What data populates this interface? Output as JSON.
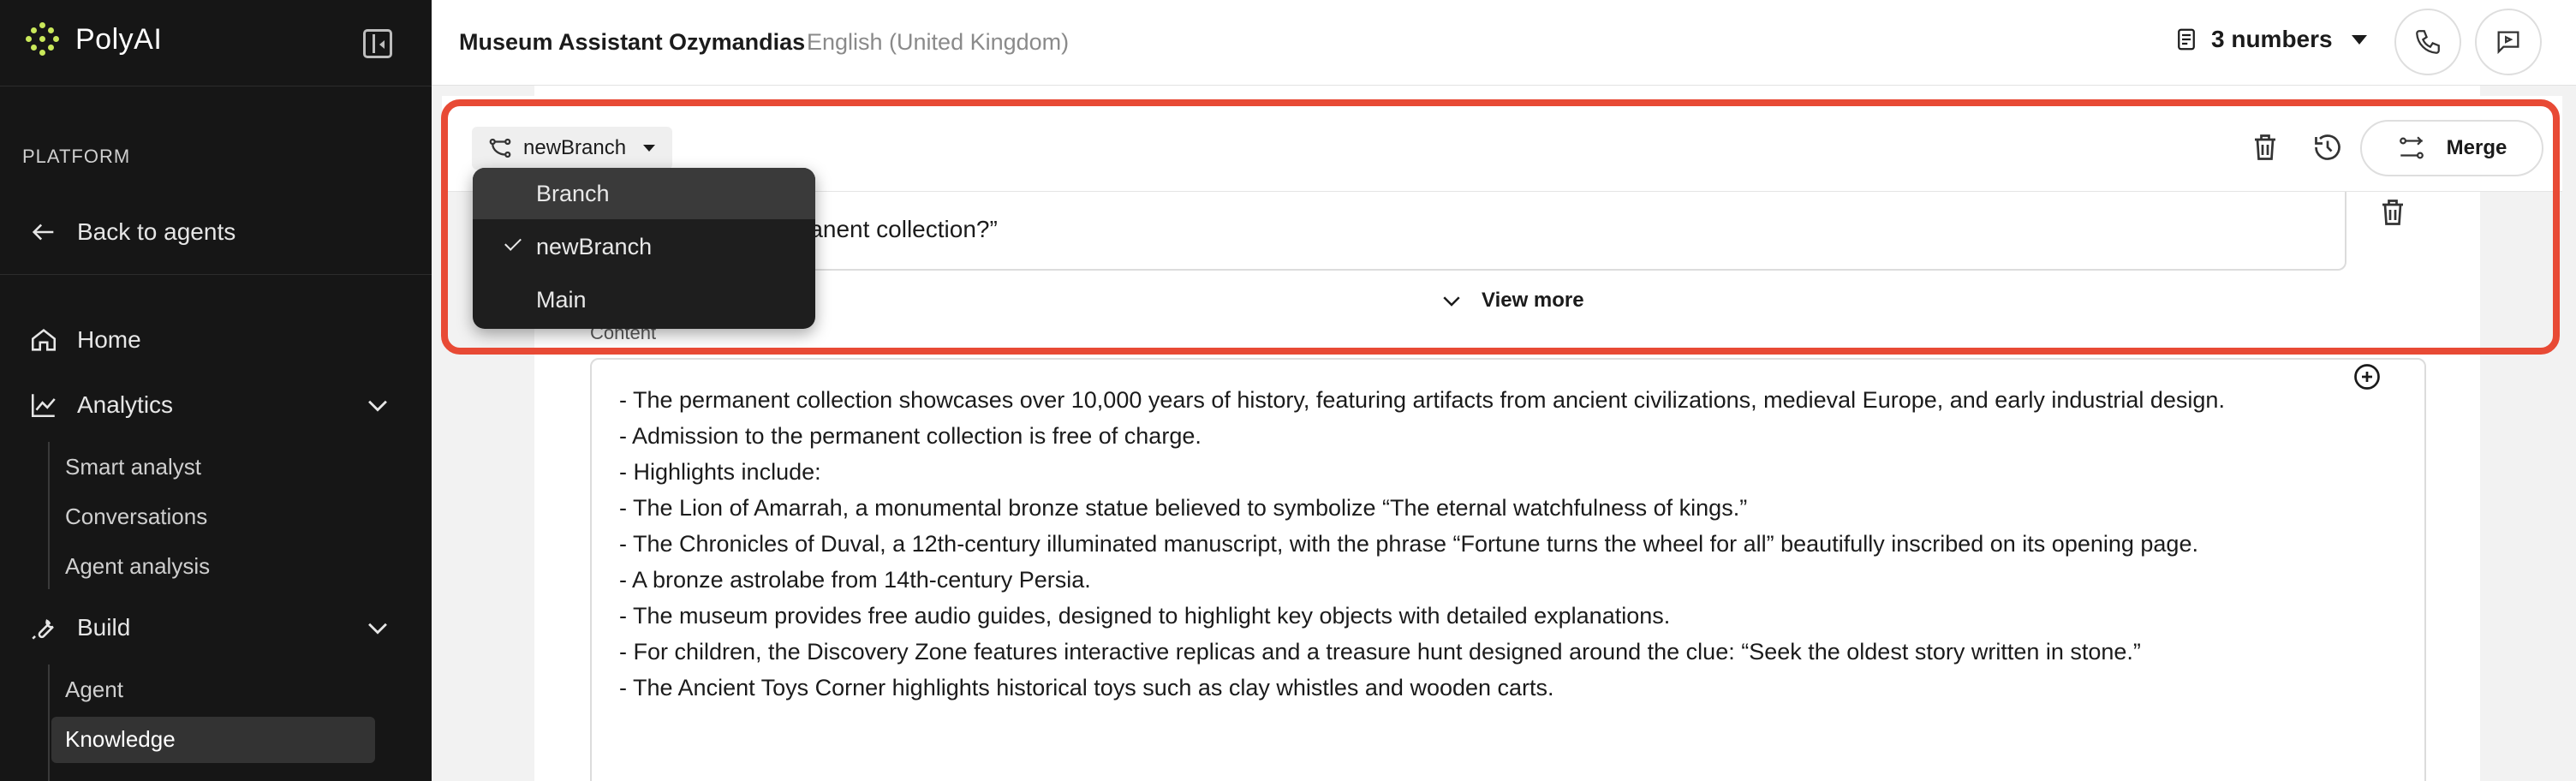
{
  "app": {
    "name": "PolyAI"
  },
  "sidebar": {
    "section_label": "PLATFORM",
    "back_label": "Back to agents",
    "home_label": "Home",
    "analytics_label": "Analytics",
    "analytics_items": [
      "Smart analyst",
      "Conversations",
      "Agent analysis"
    ],
    "build_label": "Build",
    "build_items": [
      "Agent",
      "Knowledge"
    ],
    "active_item": "Knowledge"
  },
  "header": {
    "agent_name": "Museum Assistant Ozymandias",
    "language": "English (United Kingdom)",
    "numbers_label": "3 numbers"
  },
  "branch": {
    "current": "newBranch",
    "merge_label": "Merge",
    "dropdown": {
      "items": [
        {
          "label": "Branch",
          "highlighted": true,
          "checked": false
        },
        {
          "label": "newBranch",
          "highlighted": false,
          "checked": true
        },
        {
          "label": "Main",
          "highlighted": false,
          "checked": false
        }
      ]
    }
  },
  "knowledge": {
    "question_partial": "manent collection?”",
    "view_more_label": "View more",
    "content_label": "Content",
    "content_lines": [
      "- The permanent collection showcases over 10,000 years of history, featuring artifacts from ancient civilizations, medieval Europe, and early industrial design.",
      "- Admission to the permanent collection is free of charge.",
      "- Highlights include:",
      "- The Lion of Amarrah, a monumental bronze statue believed to symbolize “The eternal watchfulness of kings.”",
      "- The Chronicles of Duval, a 12th-century illuminated manuscript, with the phrase “Fortune turns the wheel for all” beautifully inscribed on its opening page.",
      "- A bronze astrolabe from 14th-century Persia.",
      "- The museum provides free audio guides, designed to highlight key objects with detailed explanations.",
      "- For children, the Discovery Zone features interactive replicas and a treasure hunt designed around the clue: “Seek the oldest story written in stone.”",
      "- The Ancient Toys Corner highlights historical toys such as clay whistles and wooden carts."
    ]
  },
  "colors": {
    "accent": "#c9e85a",
    "highlight_frame": "#e84a35",
    "sidebar_bg": "#161616"
  },
  "icons": [
    "logo-icon",
    "collapse-sidebar-icon",
    "arrow-left-icon",
    "home-icon",
    "chart-icon",
    "wrench-icon",
    "chevron-down-icon",
    "document-icon",
    "phone-icon",
    "chat-icon",
    "branch-icon",
    "trash-icon",
    "history-icon",
    "merge-icon",
    "check-icon",
    "plus-circle-icon"
  ]
}
